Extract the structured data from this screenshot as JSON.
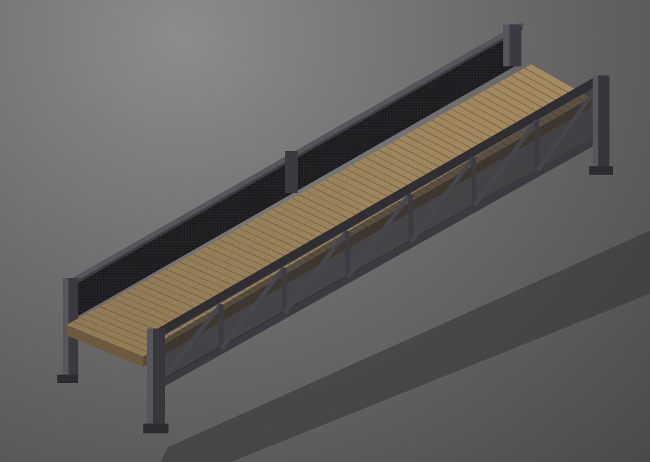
{
  "viewport": {
    "background_top": "#8c8c8c",
    "background_bottom": "#4a4a4a"
  },
  "model": {
    "subject": "bridge-truss-render",
    "colors": {
      "steel_dark": "#2f2f33",
      "steel_mid": "#44444a",
      "steel_light": "#6a6a72",
      "mesh_panel": "#1f1f22",
      "deck_wood": "#8a7450",
      "deck_wood_light": "#a38a5f",
      "deck_wood_dark": "#5b4a32",
      "shadow": "#3a3a3a"
    }
  }
}
